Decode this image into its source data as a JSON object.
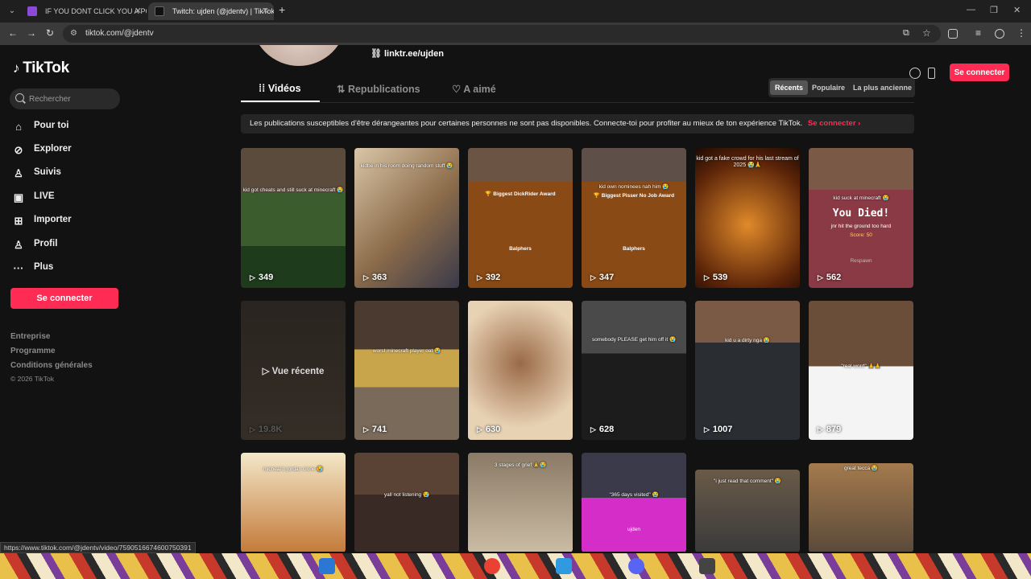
{
  "browser": {
    "tabs": [
      {
        "title": "IF YOU DONT CLICK YOU A PO",
        "active": false
      },
      {
        "title": "Twitch: ujden (@jdentv) | TikTok",
        "active": true
      }
    ],
    "url": "tiktok.com/@jdentv",
    "status_url": "https://www.tiktok.com/@jdentv/video/7590516674600750391"
  },
  "sidebar": {
    "brand": "TikTok",
    "search_placeholder": "Rechercher",
    "nav": [
      {
        "label": "Pour toi",
        "icon": "home-icon"
      },
      {
        "label": "Explorer",
        "icon": "compass-icon"
      },
      {
        "label": "Suivis",
        "icon": "person-icon"
      },
      {
        "label": "LIVE",
        "icon": "live-icon"
      },
      {
        "label": "Importer",
        "icon": "plus-square-icon"
      },
      {
        "label": "Profil",
        "icon": "profile-icon"
      },
      {
        "label": "Plus",
        "icon": "more-icon"
      }
    ],
    "login_button": "Se connecter",
    "footer_links": [
      "Entreprise",
      "Programme",
      "Conditions générales"
    ],
    "copyright": "© 2026 TikTok"
  },
  "header": {
    "login_button": "Se connecter"
  },
  "profile": {
    "link": "linktr.ee/ujden",
    "tabs": [
      "Vidéos",
      "Republications",
      "A aimé"
    ],
    "sort": [
      "Récents",
      "Populaire",
      "La plus ancienne"
    ],
    "notice": "Les publications susceptibles d'être dérangeantes pour certaines personnes ne sont pas disponibles. Connecte-toi pour profiter au mieux de ton expérience TikTok.",
    "notice_cta": "Se connecter"
  },
  "videos": [
    {
      "views": "349",
      "caption": "kid got cheats and still suck at minecraft 😭"
    },
    {
      "views": "363",
      "caption": "kidbe in his room doing random stuff 😭"
    },
    {
      "views": "392",
      "caption": "Biggest DickRider Award",
      "label": "Balphers"
    },
    {
      "views": "347",
      "caption": "kid own nominees nah him 😭",
      "award": "Biggest Pisser No Job Award",
      "label": "Balphers"
    },
    {
      "views": "539",
      "caption": "kid got a fake crowd for his last stream of 2025 😭🙏"
    },
    {
      "views": "562",
      "caption": "kid suck at minecraft 😭",
      "died": "You Died!",
      "died_sub": "jnr hit the ground too hard",
      "score_label": "Score:",
      "score": "50",
      "respawn": "Respawn"
    },
    {
      "views": "19.8K",
      "overlay": "Vue récente"
    },
    {
      "views": "741",
      "caption": "worst minecraft player oat 😭"
    },
    {
      "views": "630",
      "caption": ""
    },
    {
      "views": "628",
      "caption": "somebody PLEASE get him off it 😭"
    },
    {
      "views": "1007",
      "caption": "kid u a dirty nga 😭"
    },
    {
      "views": "879",
      "caption": "\"real word\" 🙏🙏"
    },
    {
      "views": "",
      "caption": "micheal b jordan clone 😭"
    },
    {
      "views": "",
      "caption": "yall not listening 😭"
    },
    {
      "views": "",
      "caption": "3 stages of grief 🙏😭"
    },
    {
      "views": "",
      "caption": "\"365 days visited\" 😭",
      "label": "ujden"
    },
    {
      "views": "",
      "caption": "\"i just read that comment\" 😭"
    },
    {
      "views": "",
      "caption": "great tecca 😭"
    }
  ],
  "colors": {
    "accent": "#fe2c55",
    "background": "#121212"
  }
}
